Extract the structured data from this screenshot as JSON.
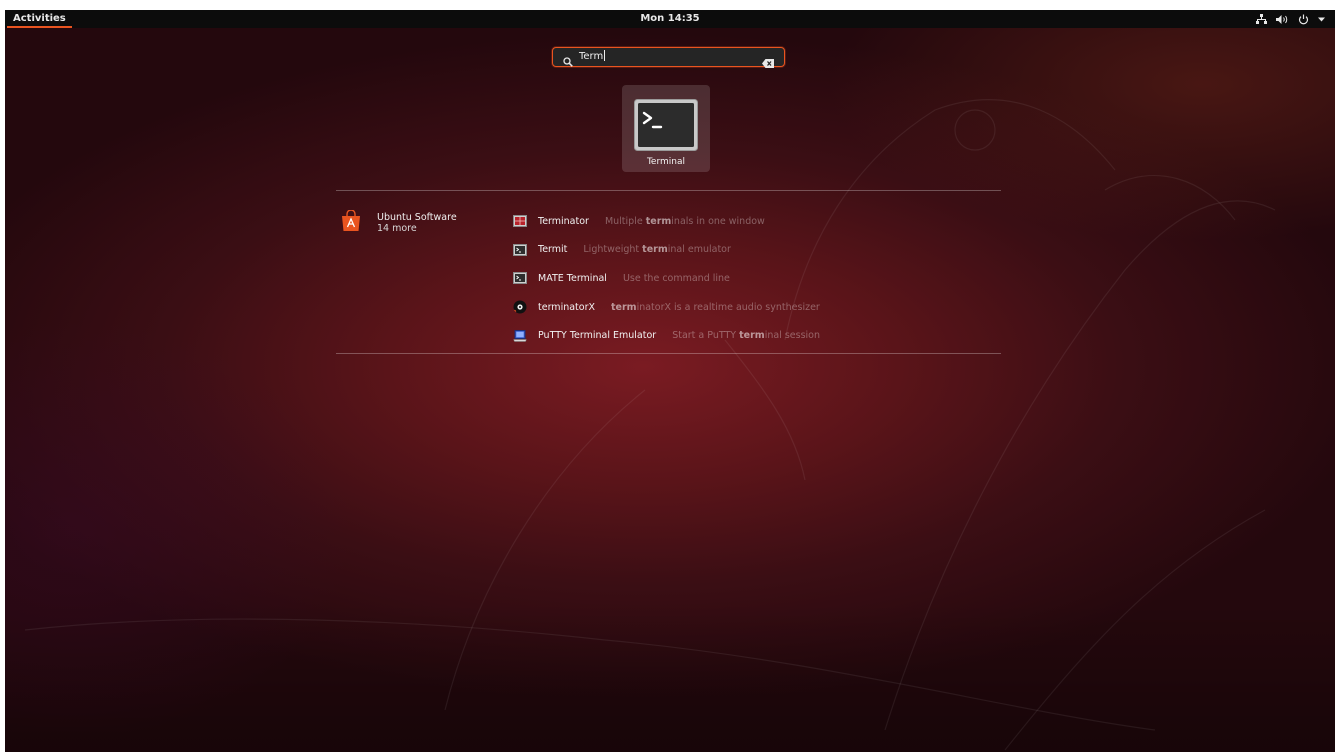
{
  "topbar": {
    "activities_label": "Activities",
    "clock": "Mon 14:35",
    "tray_icons": [
      "network-icon",
      "volume-icon",
      "power-icon",
      "tray-menu-arrow-icon"
    ]
  },
  "search": {
    "query": "Term"
  },
  "featured": {
    "label": "Terminal",
    "icon": "terminal-icon"
  },
  "provider": {
    "name": "Ubuntu Software",
    "more": "14 more",
    "icon": "ubuntu-software-icon"
  },
  "results": [
    {
      "name": "Terminator",
      "desc_before": "Multiple ",
      "desc_bold": "term",
      "desc_after": "inals in one window",
      "icon": "terminator-icon"
    },
    {
      "name": "Termit",
      "desc_before": "Lightweight ",
      "desc_bold": "term",
      "desc_after": "inal emulator",
      "icon": "termit-icon"
    },
    {
      "name": "MATE Terminal",
      "desc_before": "Use the command line",
      "desc_bold": "",
      "desc_after": "",
      "icon": "mate-terminal-icon"
    },
    {
      "name": "terminatorX",
      "desc_before": "",
      "desc_bold": "term",
      "desc_after": "inatorX is a realtime audio synthesizer",
      "icon": "terminatorx-icon"
    },
    {
      "name": "PuTTY Terminal Emulator",
      "desc_before": "Start a PuTTY ",
      "desc_bold": "term",
      "desc_after": "inal session",
      "icon": "putty-icon"
    }
  ],
  "colors": {
    "accent": "#e95420",
    "topbar": "#0c0c0c",
    "wallpaper": "#5a1419"
  }
}
